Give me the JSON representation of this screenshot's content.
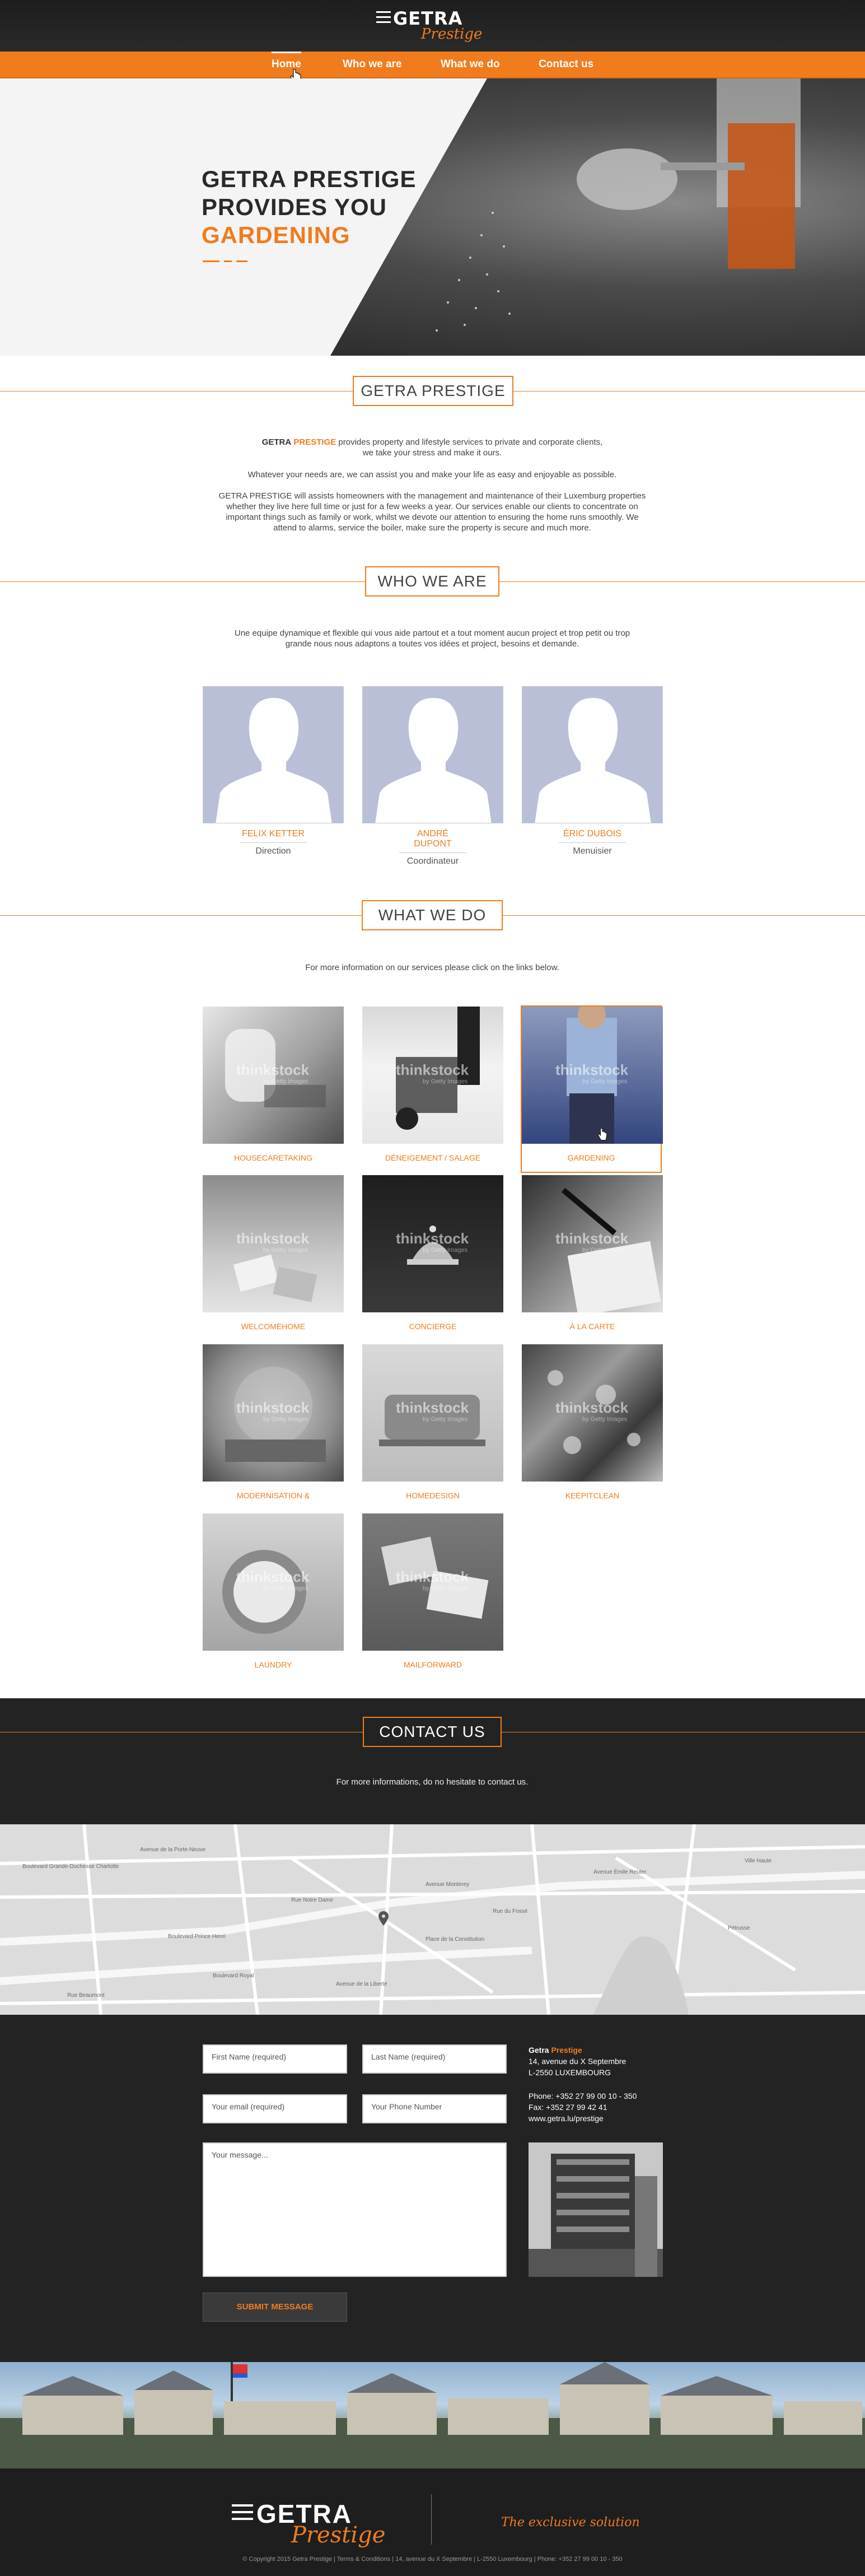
{
  "header": {
    "logo_main": "GETRA",
    "logo_sub": "Prestige",
    "nav": [
      {
        "label": "Home",
        "active": true
      },
      {
        "label": "Who we are",
        "active": false
      },
      {
        "label": "What we do",
        "active": false
      },
      {
        "label": "Contact us",
        "active": false
      }
    ]
  },
  "hero": {
    "line1": "GETRA PRESTIGE",
    "line2": "PROVIDES YOU",
    "line3": "GARDENING"
  },
  "intro": {
    "heading": "GETRA PRESTIGE",
    "p1_brand": "GETRA",
    "p1_brand_accent": "PRESTIGE",
    "p1_rest": " provides property and lifestyle services to private and corporate clients,",
    "p1_line2": "we take your stress and make it ours.",
    "p2": "Whatever your needs are, we can assist you and make your life as easy and enjoyable as possible.",
    "p3_l1": "GETRA PRESTIGE will assists homeowners with the management and maintenance of their Luxemburg properties",
    "p3_l2": "whether they live here full time or just for a few weeks a year. Our services enable our clients to concentrate on",
    "p3_l3": "important things such as family or work, whilst we devote our attention to ensuring the home runs smoothly. We",
    "p3_l4": "attend to alarms, service the boiler, make sure the property is secure and much more."
  },
  "who": {
    "heading": "WHO WE ARE",
    "text_l1": "Une equipe dynamique et flexible qui vous aide partout et a tout moment aucun project et trop petit ou trop",
    "text_l2": "grande nous nous adaptons a toutes vos idées et project, besoins et demande.",
    "members": [
      {
        "name": "FELIX KETTER",
        "role": "Direction"
      },
      {
        "name": "ANDRÉ DUPONT",
        "role": "Coordinateur"
      },
      {
        "name": "ÉRIC DUBOIS",
        "role": "Menuisier"
      }
    ]
  },
  "what": {
    "heading": "WHAT WE DO",
    "text": "For more information on our services please click on the links below.",
    "watermark": "thinkstock",
    "watermark_sub": "by Getty Images",
    "services": [
      {
        "label": "HOUSECARETAKING"
      },
      {
        "label": "DÉNEIGEMENT / SALAGE"
      },
      {
        "label": "GARDENING",
        "selected": true
      },
      {
        "label": "WELCOMEHOME"
      },
      {
        "label": "CONCIERGE"
      },
      {
        "label": "À LA CARTE"
      },
      {
        "label": "MODERNISATION & REFURBISHMENT"
      },
      {
        "label": "HOMEDESIGN"
      },
      {
        "label": "KEEPITCLEAN"
      },
      {
        "label": "LAUNDRY"
      },
      {
        "label": "MAILFORWARD"
      }
    ]
  },
  "contact": {
    "heading": "CONTACT US",
    "text": "For more informations, do no hesitate to contact us.",
    "map_labels": [
      "Avenue Monterey",
      "Boulevard Grande-Duchesse Charlotte",
      "Avenue de la Porte-Neuve",
      "Avenue Émile Reuter",
      "Boulevard Prince Henri",
      "Rue Notre Dame",
      "Boulevard Royal",
      "Avenue de la Liberté",
      "Rue du Fossé",
      "Place de la Constitution",
      "Pétrusse",
      "Ville Haute",
      "Rue Beaumont"
    ],
    "fields": {
      "first_name": "First Name (required)",
      "last_name": "Last Name (required)",
      "email": "Your email (required)",
      "phone": "Your Phone Number",
      "message": "Your message..."
    },
    "submit": "SUBMIT MESSAGE",
    "company_main": "Getra",
    "company_accent": "Prestige",
    "address1": "14, avenue du X Septembre",
    "address2": "L-2550 LUXEMBOURG",
    "phone": "Phone: +352 27 99 00 10 - 350",
    "fax": "Fax: +352 27 99 42 41",
    "web": "www.getra.lu/prestige"
  },
  "footer": {
    "logo_main": "GETRA",
    "logo_sub": "Prestige",
    "slogan": "The exclusive solution",
    "copyright": "© Copyright 2015 Getra Prestige  |  Terms & Conditions  |  14, avenue du X Septembre  |  L-2550 Luxembourg  |  Phone: +352 27 99 00 10 - 350"
  },
  "colors": {
    "accent": "#f07c1e",
    "dark": "#232323"
  }
}
